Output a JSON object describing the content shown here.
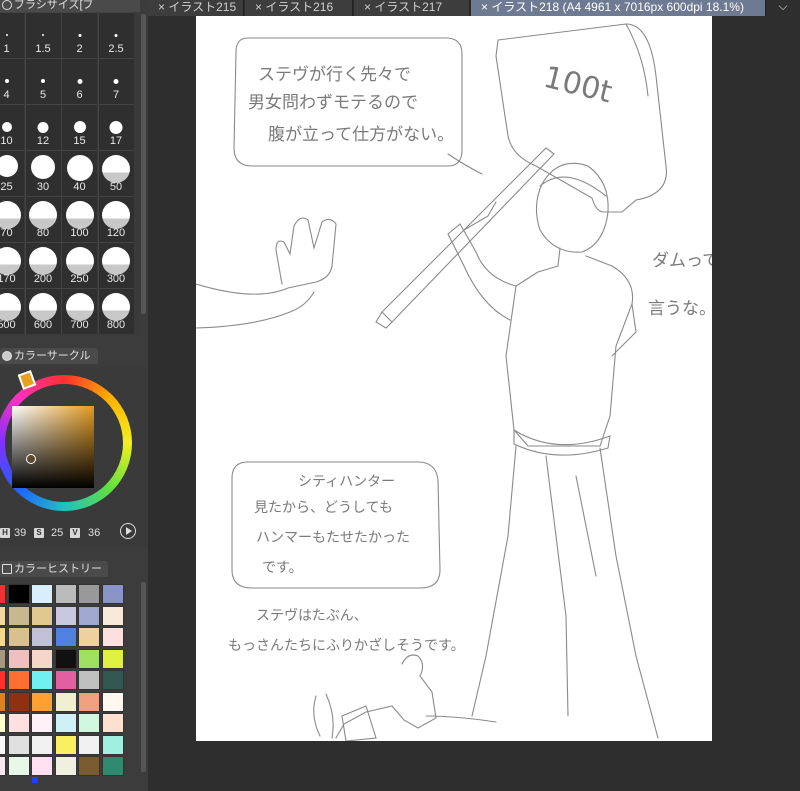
{
  "tool_panel": {
    "tab_label": "ブラシサイズ[ブ"
  },
  "brush_sizes": [
    "1",
    "1.5",
    "2",
    "2.5",
    "4",
    "5",
    "6",
    "7",
    "10",
    "12",
    "15",
    "17",
    "25",
    "30",
    "40",
    "50",
    "70",
    "80",
    "100",
    "120",
    "170",
    "200",
    "250",
    "300",
    "500",
    "600",
    "700",
    "800"
  ],
  "color_circle": {
    "title": "カラーサークル",
    "h": "39",
    "s": "25",
    "v": "36",
    "h_label": "H",
    "s_label": "S",
    "v_label": "V"
  },
  "color_history": {
    "title": "カラーヒストリー"
  },
  "history_colors": [
    "#ee3333",
    "#000000",
    "#d9eefc",
    "#bbbbbb",
    "#999999",
    "#8a93c8",
    "#f5d6a0",
    "#c8b890",
    "#e0c890",
    "#c8c8e0",
    "#a0a8d0",
    "#f8e8d8",
    "#f5d890",
    "#d8c090",
    "#c0c0d8",
    "#5080e0",
    "#f0d0a0",
    "#fce0e0",
    "#a89880",
    "#f0c0c0",
    "#f5d6c8",
    "#111111",
    "#a0e060",
    "#e0f040",
    "#ff3030",
    "#ff7030",
    "#70f0f0",
    "#e060a0",
    "#c0c0c0",
    "#305850",
    "#e08020",
    "#903010",
    "#ffa030",
    "#f0f0d0",
    "#f0a080",
    "#fff8f0",
    "#ffffd0",
    "#ffe0e0",
    "#fff0f8",
    "#d0f0f8",
    "#d0f8e0",
    "#ffe0d0",
    "#f8f8f8",
    "#e0e0e0",
    "#f0f0f0",
    "#f8f060",
    "#f0f0f0",
    "#a0f0e0",
    "#f8e8f0",
    "#e8f8e8",
    "#ffe0f0",
    "#f0f0e0",
    "#7a5a30",
    "#308a70"
  ],
  "document_tabs": [
    {
      "label": "イラスト215",
      "active": false
    },
    {
      "label": "イラスト216",
      "active": false
    },
    {
      "label": "イラスト217",
      "active": false
    },
    {
      "label": "イラスト218 (A4 4961 x 7016px 600dpi 18.1%)",
      "active": true
    }
  ],
  "tab_close_glyph": "×",
  "dropdown_glyph": "⌵",
  "canvas_text": {
    "bubble1": [
      "ステヴが行く先々で",
      "男女問わずモテるので",
      "腹が立って仕方がない。"
    ],
    "sign": "100t",
    "side_note": [
      "ダムって",
      "言うな。"
    ],
    "bubble2": [
      "シティハンター",
      "見たから、どうしても",
      "ハンマーもたせたかった",
      "です。"
    ],
    "note": [
      "ステヴはたぶん、",
      "もっさんたちにふりかざしそうです。"
    ]
  },
  "colors": {
    "accent_tab": "#6d7a92",
    "selected_color": "#5b4a2f"
  }
}
